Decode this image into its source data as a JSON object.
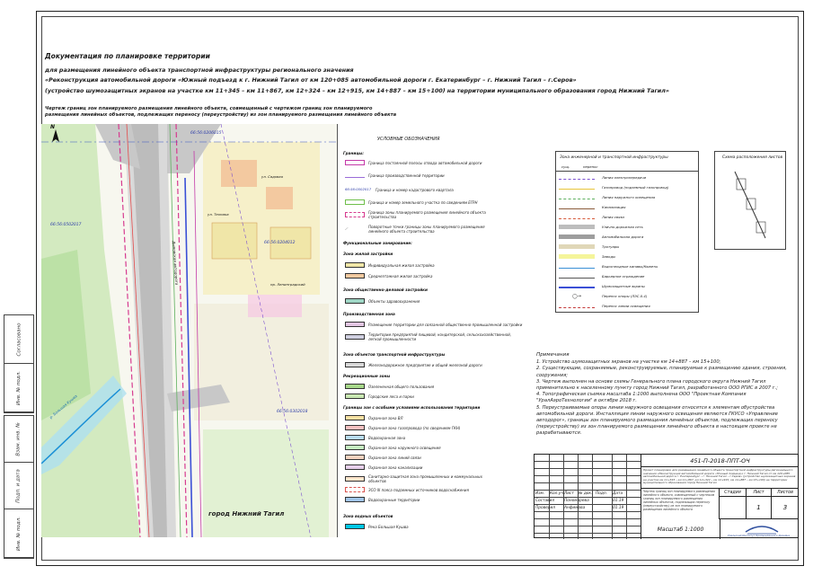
{
  "document": {
    "title": "Документация по планировке территории",
    "subtitle": "для размещения линейного объекта транспортной инфраструктуры регионального значения",
    "object_line": "«Реконструкция автомобильной дороги «Южный подъезд к г. Нижний Тагил от км 120+085 автомобильной дороги г. Екатеринбург – г. Нижний Тагил – г.Серов»",
    "scope_line": "(устройство шумозащитных экранов на участке км 11+345 – км 11+867, км 12+324 – км 12+915, км 14+887 – км 15+100) на территории муниципального образования город Нижний Тагил»",
    "drawing_title": "Чертеж границ зон планируемого размещения линейного объекта, совмещенный с чертежом границ зон планируемого размещения линейных объектов, подлежащих переносу (переустройству) из зон планируемого размещения линейного объекта"
  },
  "side_stamp": {
    "labels": [
      "Согласовано",
      "Инв. № подл.",
      "Подп. и дата",
      "Взам. инв. №",
      "Подп. и дата",
      "Инв. № подл.",
      "Изм.",
      "Кол.уч"
    ]
  },
  "map": {
    "north": "N",
    "cadastral_labels": [
      "66:56:0206015",
      "66:56:0502017",
      "66:56:0204012",
      "66:56:0502017",
      "66:56:0302018"
    ],
    "street_labels": [
      "Дымовская автодорога",
      "ул. Садовая",
      "ул. Техника",
      "пр. Ленинградский"
    ],
    "city_label": "город Нижний Тагил",
    "river_label": "р. Большая Кушва"
  },
  "legend": {
    "title": "УСЛОВНЫЕ ОБОЗНАЧЕНИЯ",
    "sections": {
      "borders": "Границы:",
      "functional": "Функциональные зонирование:",
      "residential": "Зона жилой застройки",
      "public": "Зона общественно-деловой застройки",
      "production": "Производственная зона",
      "transport": "Зона объектов транспортной инфраструктуры",
      "recreation": "Рекреационные зоны",
      "special": "Границы зон с особыми условиями использования территории",
      "water": "Зона водных объектов"
    },
    "items": [
      {
        "label": "Граница постоянной полосы отвода автомобильной дороги",
        "color": "#c43aa8"
      },
      {
        "label": "Граница производственной территории",
        "color": "#9a6bd8"
      },
      {
        "label": "Граница и номер кадастрового квартала",
        "code": "66:56:0502017",
        "color": "#3a57c4"
      },
      {
        "label": "Граница и номер земельного участка по сведениям ЕГРН",
        "color": "#6fbf4a"
      },
      {
        "label": "Граница зоны планируемого размещения линейного объекта строительства",
        "color": "#d63a8f"
      },
      {
        "label": "Поворотные точки границы зоны планируемого размещения линейного объекта строительства",
        "color": "#222222"
      },
      {
        "label": "Индивидуальная жилая застройка",
        "color": "#f0e6a8"
      },
      {
        "label": "Среднеэтажная жилая застройка",
        "color": "#f3c9a0"
      },
      {
        "label": "Объекты здравоохранения",
        "color": "#9fd6c5"
      },
      {
        "label": "Размещение территории для связанной общественно-промышленной застройки",
        "color": "#e3c6e3"
      },
      {
        "label": "Территории предприятий пищевой, кондитерской, сельскохозяйственной, легкой промышленности",
        "color": "#cfcfe0"
      },
      {
        "label": "Железнодорожное предприятие и общей железной дороги",
        "color": "#d8d8d8"
      },
      {
        "label": "Озелененная общего пользования",
        "color": "#a7d88a"
      },
      {
        "label": "Городские леса и парки",
        "color": "#c9e8b2"
      },
      {
        "label": "Охранная зона ВЛ",
        "color": "#f7e0a3"
      },
      {
        "label": "Охранная зона газопровода (по сведениям ГКН)",
        "color": "#f7c1c1"
      },
      {
        "label": "Водоохранная зона",
        "color": "#b8dcf2"
      },
      {
        "label": "Охранная зона наружного освещения",
        "color": "#c6f0c1"
      },
      {
        "label": "Охранная зона линий связи",
        "color": "#f5d3c0"
      },
      {
        "label": "Охранная зона канализации",
        "color": "#e7d0ec"
      },
      {
        "label": "Санитарно-защитная зона промышленных и коммунальных объектов",
        "color": "#ffe6cc"
      },
      {
        "label": "ЗСО III пояса подземных источников водоснабжения",
        "color": "#d9534f"
      },
      {
        "label": "Водоохранные территории",
        "color": "#a0c4e8"
      },
      {
        "label": "Река Большая Кушва",
        "color": "#00c8e6"
      }
    ]
  },
  "engineering_legend": {
    "title": "Зона инженерной и транспортной инфраструктуры",
    "head_left": "сущ.",
    "head_right": "перенос",
    "items": [
      {
        "label": "Линия электропередачи",
        "color": "#7a4fd0"
      },
      {
        "label": "Газопровод (подземный газопровод)",
        "color": "#e8c53a"
      },
      {
        "label": "Линия наружного освещения",
        "color": "#5fb05f"
      },
      {
        "label": "Канализация",
        "color": "#8a5a3a"
      },
      {
        "label": "Линия связи",
        "color": "#d65a3a"
      },
      {
        "label": "Улично-дорожная сеть",
        "color": "#bdbdbd"
      },
      {
        "label": "Автомобильная дорога",
        "color": "#9e9e9e"
      },
      {
        "label": "Тротуары",
        "color": "#e0d7b8"
      },
      {
        "label": "Заводы",
        "color": "#f5f59a"
      },
      {
        "label": "Водоотводные канавы/Кюветы",
        "color": "#3a8fd6"
      },
      {
        "label": "Барьерное ограждение",
        "color": "#555555"
      },
      {
        "label": "Шумозащитные экраны",
        "color": "#3a4fd6"
      },
      {
        "label": "Перенос опоры (ЛЭС-0.4)",
        "color": "#333333"
      },
      {
        "label": "Перенос линии освещения",
        "color": "#c43a3a"
      }
    ]
  },
  "situation": {
    "title": "Схема расположения листов"
  },
  "notes": {
    "title": "Примечания",
    "items": [
      "1. Устройство шумозащитных экранов на участке км 14+887 – км 15+100;",
      "2. Существующие, сохраняемые, реконструируемые, планируемые к размещению здания, строения, сооружения;",
      "3. Чертеж выполнен на основе схемы Генерального плана городского округа Нижний Тагил применительно к населенному пункту город Нижний Тагил, разработанного ООО РГИС в 2007 г.;",
      "4. Топографическая съемка масштаба 1:1000 выполнена ООО \"Проектная Компания \"УралАэроТехнологии\" в октябре 2018 г.",
      "5. Переустраиваемые опоры линии наружного освещения относятся к элементам обустройства автомобильной дороги. Инсталляция линии наружного освещения являются ГКУСО «Управление автодорог», границы зон планируемого размещения линейных объектов, подлежащих переносу (переустройству) из зон планируемого размещения линейного объекта в настоящем проекте не разрабатываются."
    ]
  },
  "stamp": {
    "code": "451-П-2018-ППТ-ОЧ",
    "description": "Проект планировки для размещения линейного объекта транспортной инфраструктуры регионального значения «Реконструкция автомобильной дороги «Южный подъезд к г. Нижний Тагил от км 120+085 автомобильной дороги г. Екатеринбург – г. Нижний Тагил – г.Серов» (устройство шумозащитных экранов на участке км 11+345 – км 11+867, км 12+324 – км 12+915, км 14+887 – км 15+100) на территории муниципального образования город Нижний Тагил",
    "sheet_desc": "Чертеж границ зон планируемого размещения линейного объекта, совмещенный с чертежом границ зон планируемого размещения линейных объектов, подлежащих переносу (переустройству) из зон планируемого размещения линейного объекта",
    "columns": [
      "Изм.",
      "Кол.уч.",
      "Лист",
      "№ док.",
      "Подп.",
      "Дата"
    ],
    "roles": [
      {
        "role": "Составил",
        "name": "Пономарева",
        "date": "01.19"
      },
      {
        "role": "Проверил",
        "name": "Анфимова",
        "date": "01.19"
      }
    ],
    "stage_label": "Стадия",
    "sheet_label": "Лист",
    "sheets_label": "Листов",
    "stage": "",
    "sheet": "1",
    "sheets": "3",
    "scale": "Масштаб 1:1000",
    "org": "Уральский Институт Промышленного Дизайна"
  }
}
